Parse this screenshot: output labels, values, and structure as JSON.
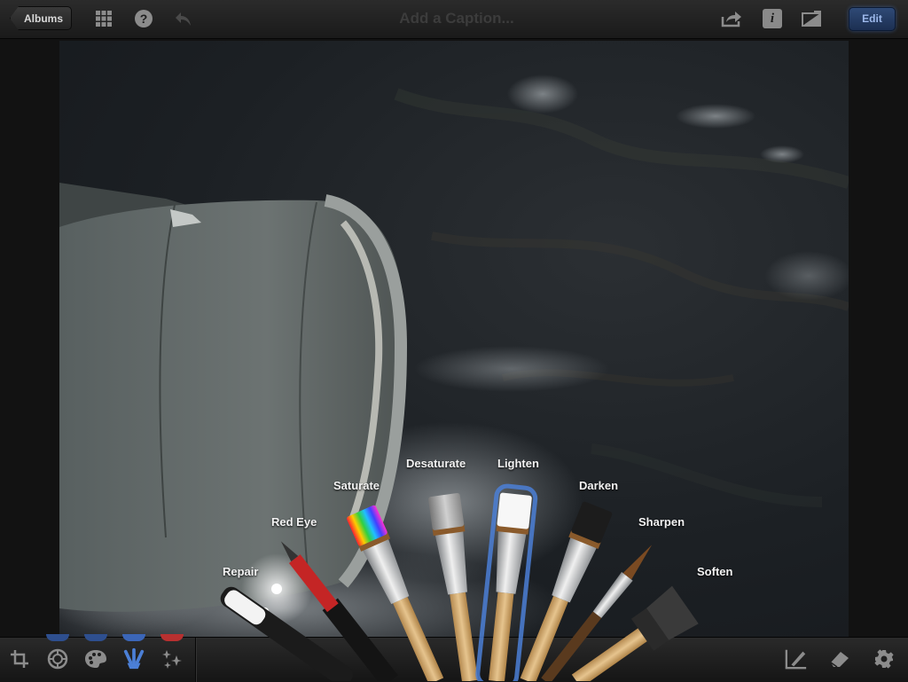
{
  "toolbar": {
    "albums_label": "Albums",
    "caption_placeholder": "Add a Caption...",
    "info_label": "i",
    "edit_label": "Edit",
    "edit_color": "#9cb8ea",
    "icons": [
      "grid-icon",
      "help-icon",
      "undo-icon",
      "share-icon",
      "info-icon",
      "compare-icon"
    ]
  },
  "brushes": [
    {
      "label": "Repair"
    },
    {
      "label": "Red Eye"
    },
    {
      "label": "Saturate"
    },
    {
      "label": "Desaturate"
    },
    {
      "label": "Lighten",
      "selected": true
    },
    {
      "label": "Darken"
    },
    {
      "label": "Sharpen"
    },
    {
      "label": "Soften"
    }
  ],
  "bottom_tools": {
    "left": [
      "crop-icon",
      "exposure-icon",
      "color-palette-icon",
      "brushes-icon",
      "effects-icon"
    ],
    "right": [
      "brush-apply-icon",
      "eraser-icon",
      "settings-gear-icon"
    ],
    "active": "brushes-icon",
    "accent_blue": "#4b7fd6",
    "accent_red": "#c23030"
  }
}
